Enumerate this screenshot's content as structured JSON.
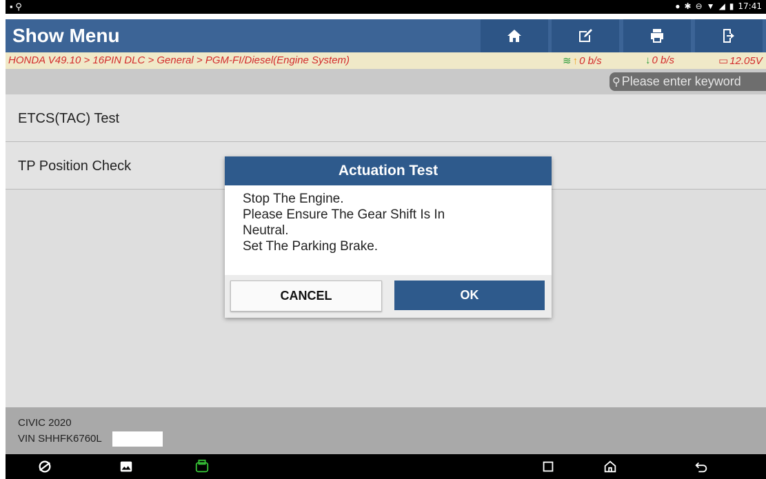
{
  "status_bar": {
    "time": "17:41",
    "icons": [
      "location-icon",
      "bluetooth-icon",
      "dnd-icon",
      "wifi-icon",
      "signal-icon",
      "battery-icon"
    ]
  },
  "header": {
    "title": "Show Menu",
    "buttons": [
      "home-icon",
      "edit-icon",
      "print-icon",
      "exit-icon"
    ]
  },
  "breadcrumb": {
    "path": "HONDA V49.10 > 16PIN DLC > General > PGM-FI/Diesel(Engine System)",
    "upload_rate": "0 b/s",
    "download_rate": "0 b/s",
    "voltage": "12.05V"
  },
  "search": {
    "placeholder": "Please enter keyword"
  },
  "menu": {
    "items": [
      {
        "label": "ETCS(TAC)  Test"
      },
      {
        "label": "TP Position Check"
      }
    ]
  },
  "footer": {
    "model": "CIVIC 2020",
    "vin": "VIN SHHFK6760L"
  },
  "dialog": {
    "title": "Actuation Test",
    "lines": [
      "Stop The Engine.",
      "Please Ensure The Gear Shift Is In",
      "Neutral.",
      "Set The Parking Brake."
    ],
    "cancel_label": "CANCEL",
    "ok_label": "OK"
  },
  "colors": {
    "header": "#3c6496",
    "header_button": "#2d5586",
    "dialog_title": "#2e5a8c",
    "breadcrumb_text": "#d22b2b",
    "breadcrumb_bg": "#f0e9c8"
  }
}
